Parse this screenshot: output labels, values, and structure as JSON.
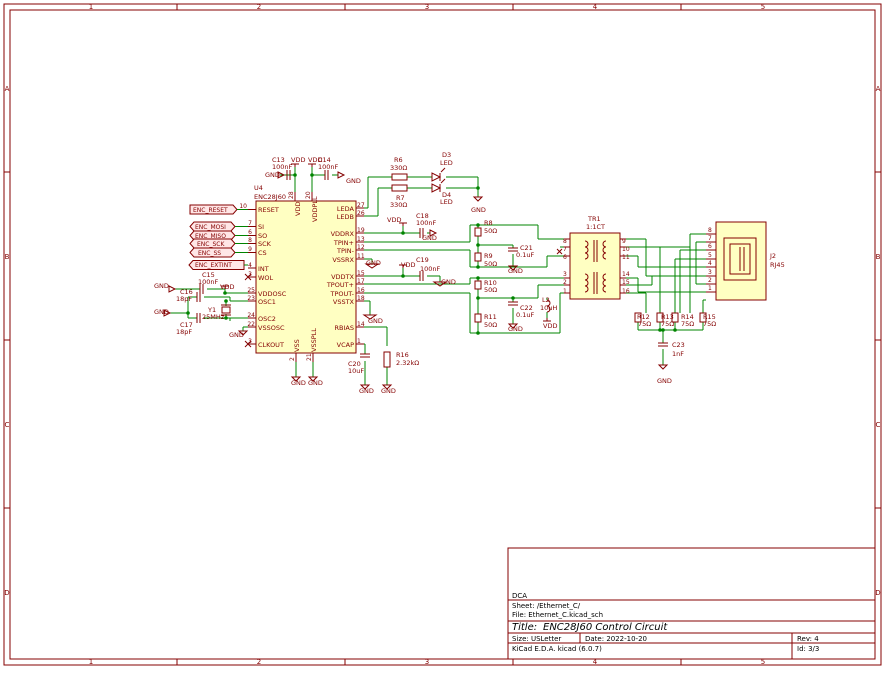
{
  "frame": {
    "columns": [
      "1",
      "2",
      "3",
      "4",
      "5"
    ],
    "rows": [
      "A",
      "B",
      "C",
      "D"
    ]
  },
  "ic": {
    "ref": "U4",
    "value": "ENC28J60",
    "left_pins": [
      {
        "num": "10",
        "name": "RESET"
      },
      {
        "num": "7",
        "name": "SI"
      },
      {
        "num": "6",
        "name": "SO"
      },
      {
        "num": "8",
        "name": "SCK"
      },
      {
        "num": "9",
        "name": "CS"
      },
      {
        "num": "4",
        "name": "INT"
      },
      {
        "num": "3",
        "name": "WOL"
      },
      {
        "num": "25",
        "name": "VDDOSC"
      },
      {
        "num": "23",
        "name": "OSC1"
      },
      {
        "num": "24",
        "name": "OSC2"
      },
      {
        "num": "22",
        "name": "VSSOSC"
      },
      {
        "num": "3",
        "name": "CLKOUT"
      }
    ],
    "right_pins": [
      {
        "num": "27",
        "name": "LEDA"
      },
      {
        "num": "26",
        "name": "LEDB"
      },
      {
        "num": "19",
        "name": "VDDRX"
      },
      {
        "num": "13",
        "name": "TPIN+"
      },
      {
        "num": "12",
        "name": "TPIN-"
      },
      {
        "num": "11",
        "name": "VSSRX"
      },
      {
        "num": "15",
        "name": "VDDTX"
      },
      {
        "num": "17",
        "name": "TPOUT+"
      },
      {
        "num": "16",
        "name": "TPOUT-"
      },
      {
        "num": "18",
        "name": "VSSTX"
      },
      {
        "num": "14",
        "name": "RBIAS"
      },
      {
        "num": "1",
        "name": "VCAP"
      }
    ],
    "top_pins": [
      {
        "num": "28",
        "name": "VDD"
      },
      {
        "num": "20",
        "name": "VDDPLL"
      }
    ],
    "bottom_pins": [
      {
        "num": "2",
        "name": "VSS"
      },
      {
        "num": "21",
        "name": "VSSPLL"
      }
    ]
  },
  "global_labels": [
    "ENC_RESET",
    "ENC_MOSI",
    "ENC_MISO",
    "ENC_SCK",
    "ENC_SS",
    "ENC_EXTINT"
  ],
  "components": {
    "c13": {
      "ref": "C13",
      "value": "100nF"
    },
    "c14": {
      "ref": "C14",
      "value": "100nF"
    },
    "c15": {
      "ref": "C15",
      "value": "100nF"
    },
    "c16": {
      "ref": "C16",
      "value": "18pF"
    },
    "c17": {
      "ref": "C17",
      "value": "18pF"
    },
    "y1": {
      "ref": "Y1",
      "value": "25MHz"
    },
    "c18": {
      "ref": "C18",
      "value": "100nF"
    },
    "c19": {
      "ref": "C19",
      "value": "100nF"
    },
    "c20": {
      "ref": "C20",
      "value": "10uF"
    },
    "r16": {
      "ref": "R16",
      "value": "2.32kΩ"
    },
    "r6": {
      "ref": "R6",
      "value": "330Ω"
    },
    "r7": {
      "ref": "R7",
      "value": "330Ω"
    },
    "d3": {
      "ref": "D3",
      "value": "LED"
    },
    "d4": {
      "ref": "D4",
      "value": "LED"
    },
    "r8": {
      "ref": "R8",
      "value": "50Ω"
    },
    "r9": {
      "ref": "R9",
      "value": "50Ω"
    },
    "r10": {
      "ref": "R10",
      "value": "50Ω"
    },
    "r11": {
      "ref": "R11",
      "value": "50Ω"
    },
    "c21": {
      "ref": "C21",
      "value": "0.1uF"
    },
    "c22": {
      "ref": "C22",
      "value": "0.1uF"
    },
    "l2": {
      "ref": "L2",
      "value": "10uH"
    },
    "tr1": {
      "ref": "TR1",
      "value": "1:1CT"
    },
    "r12": {
      "ref": "R12",
      "value": "75Ω"
    },
    "r13": {
      "ref": "R13",
      "value": "75Ω"
    },
    "r14": {
      "ref": "R14",
      "value": "75Ω"
    },
    "r15": {
      "ref": "R15",
      "value": "75Ω"
    },
    "c23": {
      "ref": "C23",
      "value": "1nF"
    },
    "j2": {
      "ref": "J2",
      "value": "RJ45"
    }
  },
  "power": {
    "vdd": "VDD",
    "gnd": "GND"
  },
  "title_block": {
    "company": "DCA",
    "sheet_line": "Sheet: /Ethernet_C/",
    "file_line": "File: Ethernet_C.kicad_sch",
    "title_prefix": "Title:",
    "title": "ENC28J60 Control Circuit",
    "size": "Size: USLetter",
    "date": "Date: 2022-10-20",
    "rev": "Rev: 4",
    "tool": "KiCad E.D.A.  kicad (6.0.7)",
    "id": "Id: 3/3"
  }
}
